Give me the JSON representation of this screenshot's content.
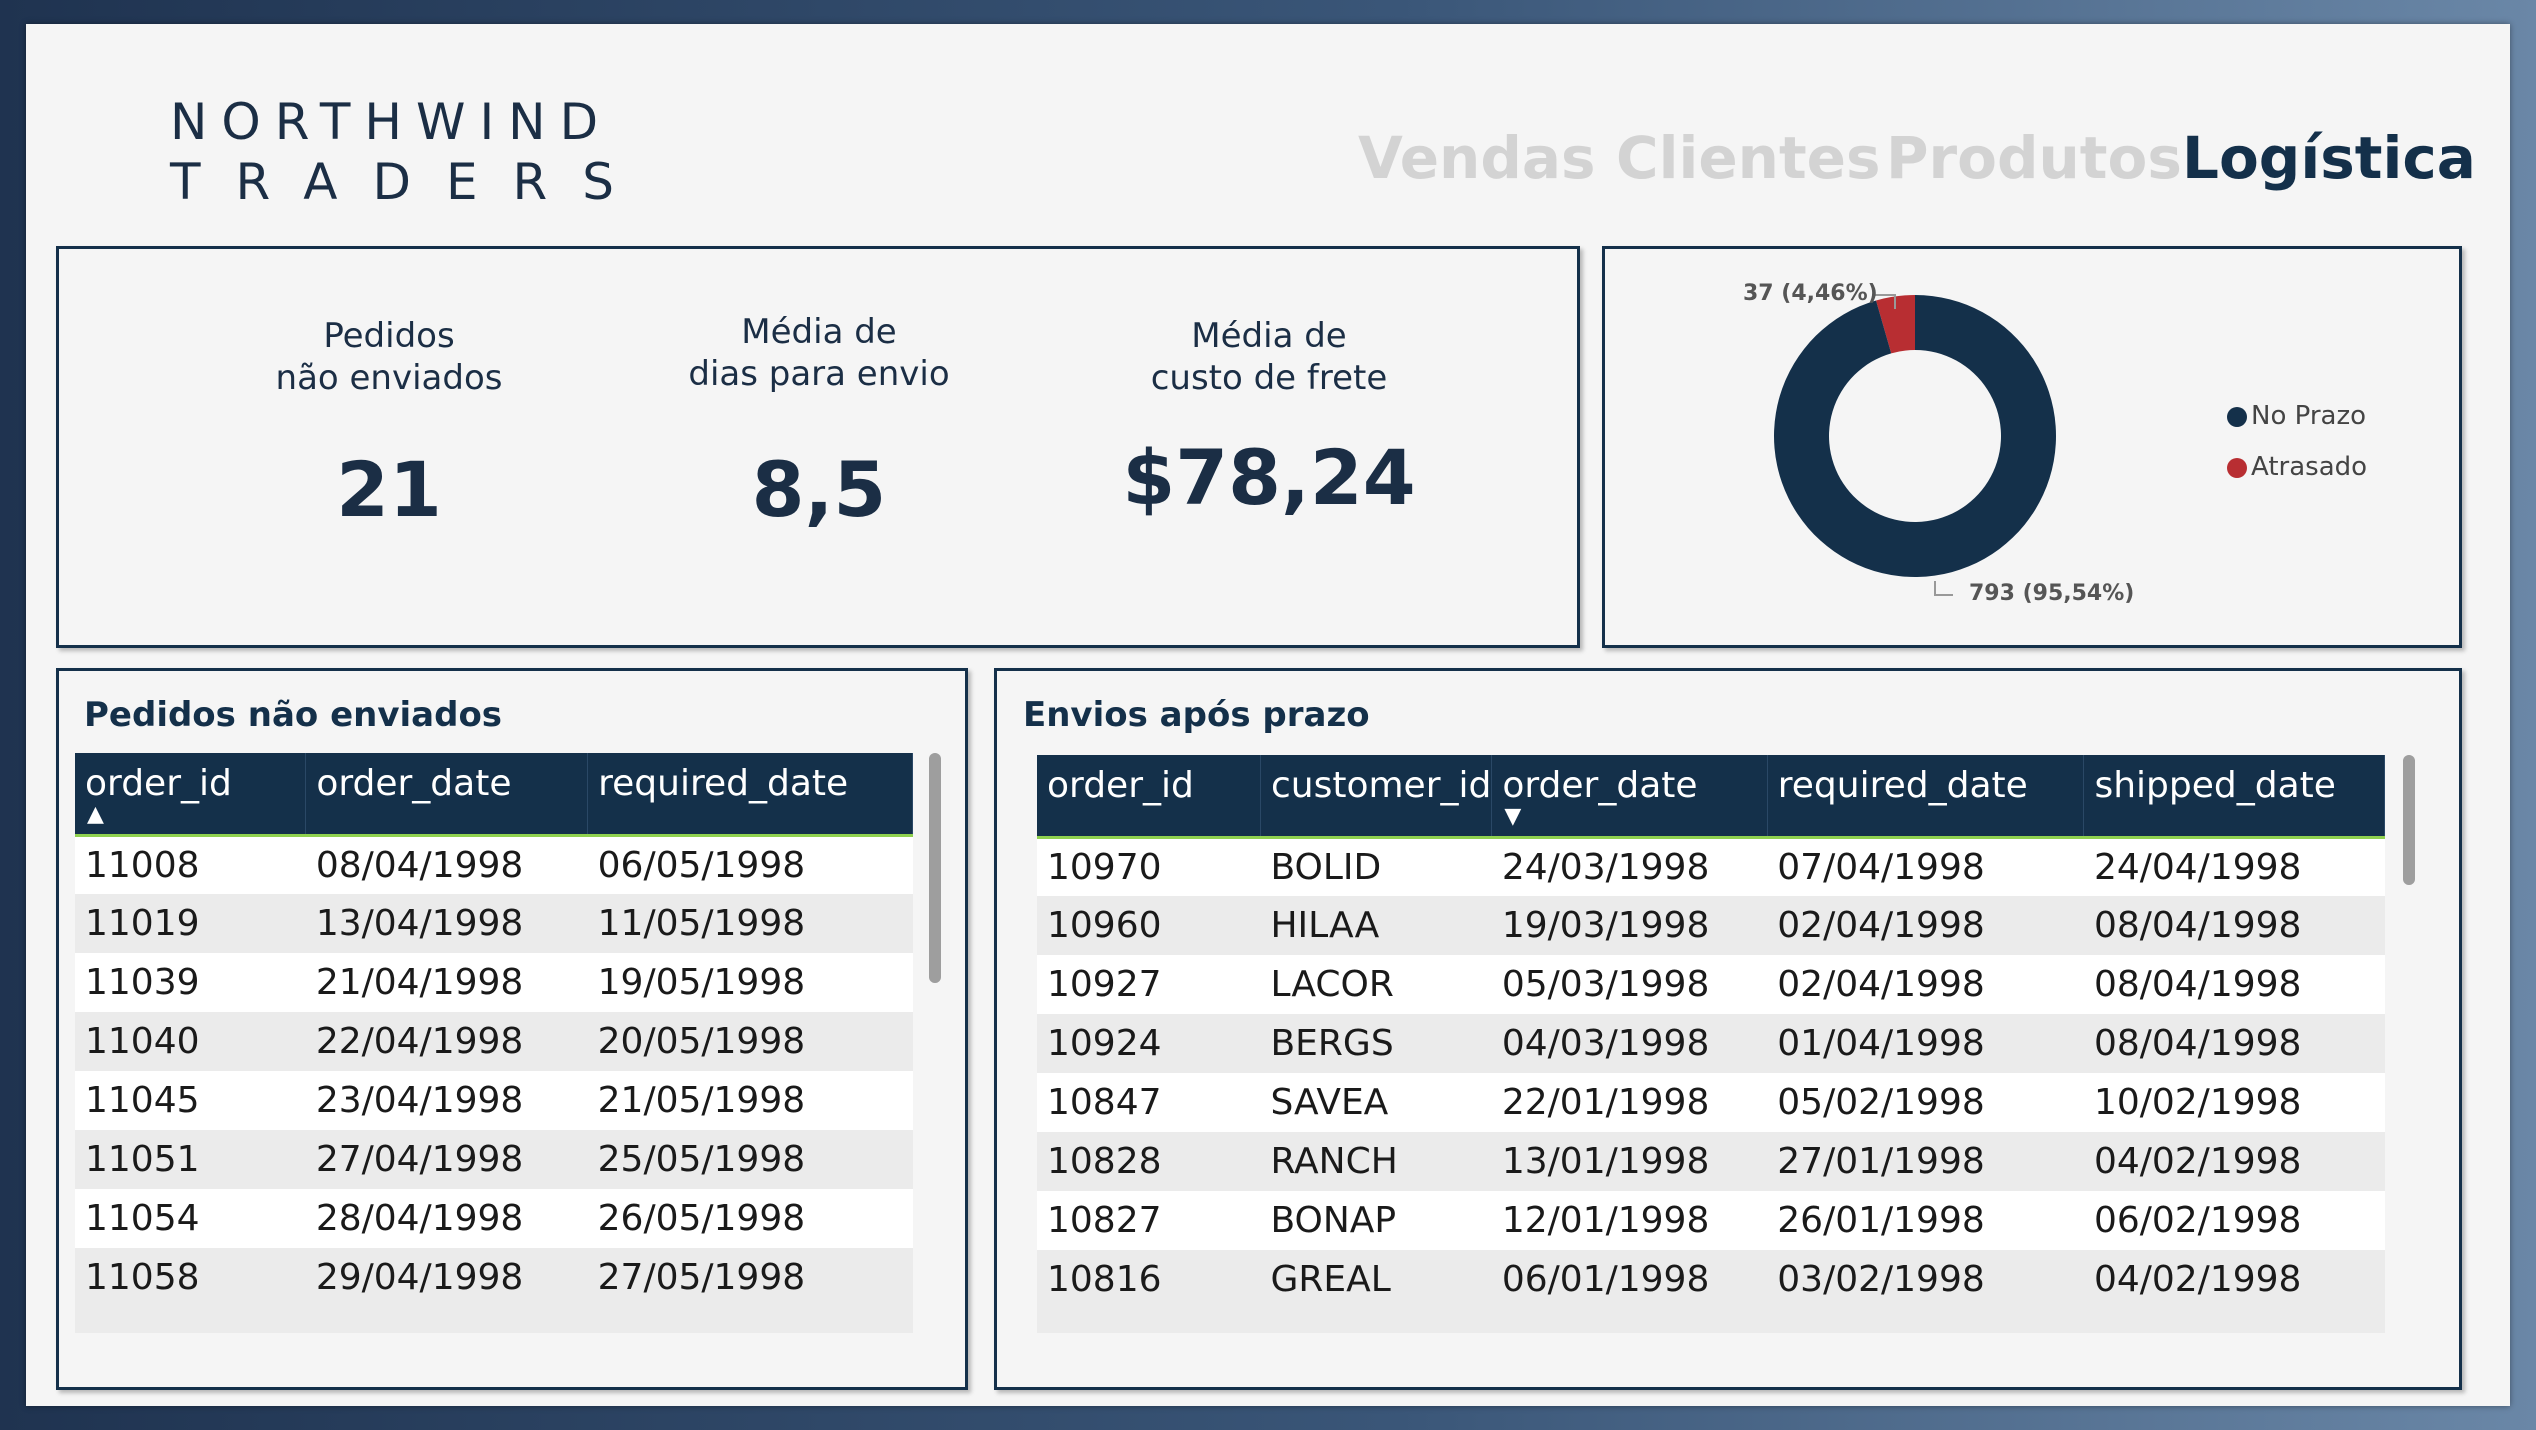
{
  "brand": {
    "line1": "NORTHWIND",
    "line2": "TRADERS"
  },
  "nav": {
    "items": [
      {
        "label": "Vendas",
        "active": false
      },
      {
        "label": "Clientes",
        "active": false
      },
      {
        "label": "Produtos",
        "active": false
      },
      {
        "label": "Logística",
        "active": true
      }
    ]
  },
  "kpis": [
    {
      "label_line1": "Pedidos",
      "label_line2": "não enviados",
      "value": "21"
    },
    {
      "label_line1": "Média de",
      "label_line2": "dias para envio",
      "value": "8,5"
    },
    {
      "label_line1": "Média de",
      "label_line2": "custo de frete",
      "value": "$78,24"
    }
  ],
  "chart_data": {
    "type": "pie",
    "donut": true,
    "labels": [
      "No Prazo",
      "Atrasado"
    ],
    "values": [
      793,
      37
    ],
    "percents": [
      "95,54%",
      "4,46%"
    ],
    "data_labels": [
      "793 (95,54%)",
      "37 (4,46%)"
    ],
    "colors": [
      "#14304a",
      "#b82e32"
    ],
    "legend_position": "right"
  },
  "legend": [
    {
      "label": "No Prazo",
      "color": "#14304a"
    },
    {
      "label": "Atrasado",
      "color": "#b82e32"
    }
  ],
  "pending_table": {
    "title": "Pedidos não enviados",
    "columns": [
      "order_id",
      "order_date",
      "required_date"
    ],
    "sort_indicator": "▲",
    "rows": [
      [
        "11008",
        "08/04/1998",
        "06/05/1998"
      ],
      [
        "11019",
        "13/04/1998",
        "11/05/1998"
      ],
      [
        "11039",
        "21/04/1998",
        "19/05/1998"
      ],
      [
        "11040",
        "22/04/1998",
        "20/05/1998"
      ],
      [
        "11045",
        "23/04/1998",
        "21/05/1998"
      ],
      [
        "11051",
        "27/04/1998",
        "25/05/1998"
      ],
      [
        "11054",
        "28/04/1998",
        "26/05/1998"
      ],
      [
        "11058",
        "29/04/1998",
        "27/05/1998"
      ]
    ]
  },
  "late_table": {
    "title": "Envios após prazo",
    "columns": [
      "order_id",
      "customer_id",
      "order_date",
      "required_date",
      "shipped_date"
    ],
    "sort_indicator": "▼",
    "rows": [
      [
        "10970",
        "BOLID",
        "24/03/1998",
        "07/04/1998",
        "24/04/1998"
      ],
      [
        "10960",
        "HILAA",
        "19/03/1998",
        "02/04/1998",
        "08/04/1998"
      ],
      [
        "10927",
        "LACOR",
        "05/03/1998",
        "02/04/1998",
        "08/04/1998"
      ],
      [
        "10924",
        "BERGS",
        "04/03/1998",
        "01/04/1998",
        "08/04/1998"
      ],
      [
        "10847",
        "SAVEA",
        "22/01/1998",
        "05/02/1998",
        "10/02/1998"
      ],
      [
        "10828",
        "RANCH",
        "13/01/1998",
        "27/01/1998",
        "04/02/1998"
      ],
      [
        "10827",
        "BONAP",
        "12/01/1998",
        "26/01/1998",
        "06/02/1998"
      ],
      [
        "10816",
        "GREAL",
        "06/01/1998",
        "03/02/1998",
        "04/02/1998"
      ]
    ]
  }
}
